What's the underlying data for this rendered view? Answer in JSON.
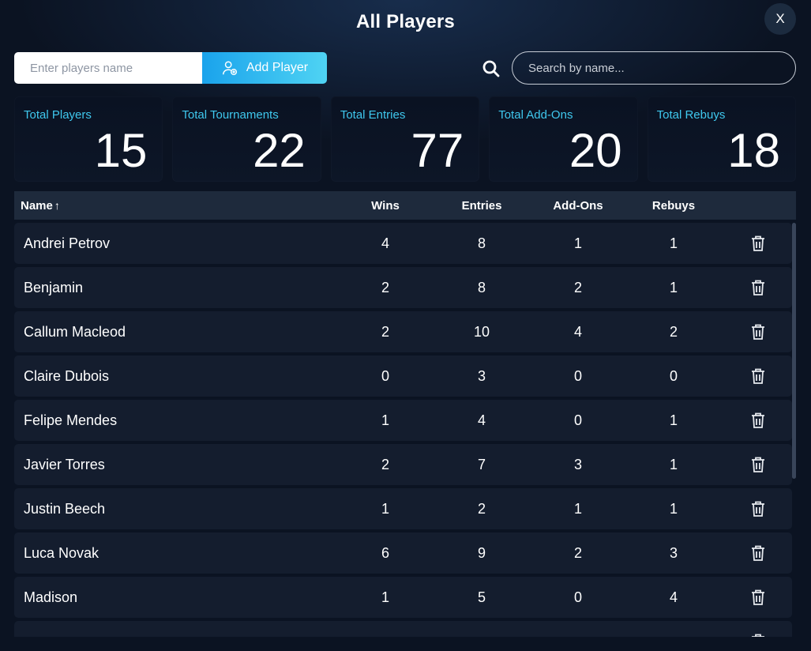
{
  "header": {
    "title": "All Players",
    "close_label": "X"
  },
  "add_player": {
    "placeholder": "Enter players name",
    "button_label": "Add Player"
  },
  "search": {
    "placeholder": "Search by name..."
  },
  "stats": [
    {
      "label": "Total Players",
      "value": "15"
    },
    {
      "label": "Total Tournaments",
      "value": "22"
    },
    {
      "label": "Total Entries",
      "value": "77"
    },
    {
      "label": "Total Add-Ons",
      "value": "20"
    },
    {
      "label": "Total Rebuys",
      "value": "18"
    }
  ],
  "table": {
    "headers": {
      "name": "Name",
      "sort_indicator": "↑",
      "wins": "Wins",
      "entries": "Entries",
      "addons": "Add-Ons",
      "rebuys": "Rebuys"
    },
    "rows": [
      {
        "name": "Andrei Petrov",
        "wins": "4",
        "entries": "8",
        "addons": "1",
        "rebuys": "1"
      },
      {
        "name": "Benjamin",
        "wins": "2",
        "entries": "8",
        "addons": "2",
        "rebuys": "1"
      },
      {
        "name": "Callum Macleod",
        "wins": "2",
        "entries": "10",
        "addons": "4",
        "rebuys": "2"
      },
      {
        "name": "Claire Dubois",
        "wins": "0",
        "entries": "3",
        "addons": "0",
        "rebuys": "0"
      },
      {
        "name": "Felipe Mendes",
        "wins": "1",
        "entries": "4",
        "addons": "0",
        "rebuys": "1"
      },
      {
        "name": "Javier Torres",
        "wins": "2",
        "entries": "7",
        "addons": "3",
        "rebuys": "1"
      },
      {
        "name": "Justin Beech",
        "wins": "1",
        "entries": "2",
        "addons": "1",
        "rebuys": "1"
      },
      {
        "name": "Luca Novak",
        "wins": "6",
        "entries": "9",
        "addons": "2",
        "rebuys": "3"
      },
      {
        "name": "Madison",
        "wins": "1",
        "entries": "5",
        "addons": "0",
        "rebuys": "4"
      }
    ]
  },
  "icons": {
    "delete": "trash-icon",
    "add": "add-user-icon",
    "search": "search-icon"
  },
  "colors": {
    "accent": "#3fc8ee",
    "button_gradient_start": "#1aa3ec",
    "button_gradient_end": "#4fd3f3",
    "background": "#0b1322"
  }
}
